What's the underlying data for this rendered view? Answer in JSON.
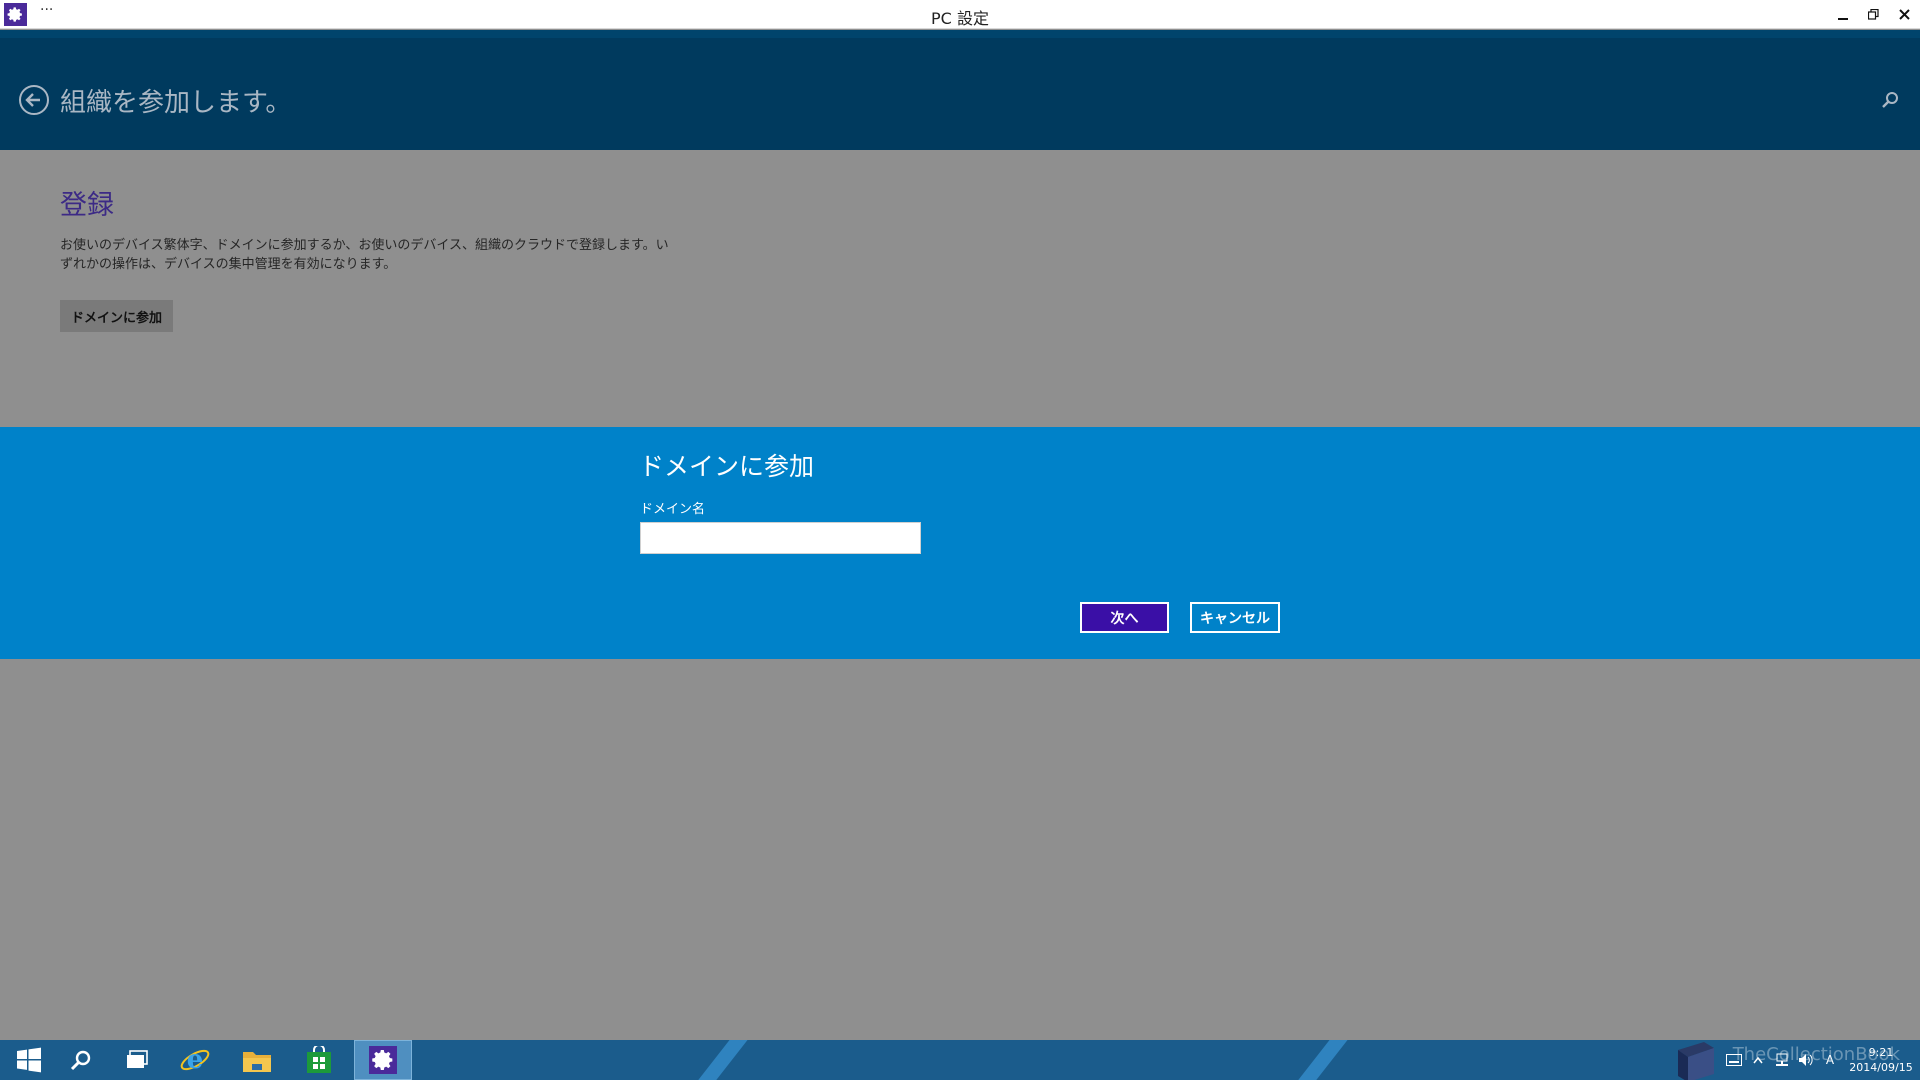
{
  "window": {
    "title": "PC 設定",
    "menu_glyph": "···"
  },
  "header": {
    "title": "組織を参加します。"
  },
  "content": {
    "section_title": "登録",
    "description": "お使いのデバイス繁体字、ドメインに参加するか、お使いのデバイス、組織のクラウドで登録します。いずれかの操作は、デバイスの集中管理を有効になります。",
    "join_button": "ドメインに参加"
  },
  "dialog": {
    "title": "ドメインに参加",
    "field_label": "ドメイン名",
    "field_value": "",
    "next_button": "次へ",
    "cancel_button": "キャンセル"
  },
  "taskbar": {
    "clock_time": "9:21",
    "clock_date": "2014/09/15",
    "ime_indicator": "A",
    "watermark": "TheCollectionBook"
  },
  "colors": {
    "header_bg": "#003a5e",
    "dialog_bg": "#0082c9",
    "next_button_bg": "#3a0fa6",
    "section_title": "#3c2a86",
    "taskbar_bg": "#1b5c8c"
  }
}
